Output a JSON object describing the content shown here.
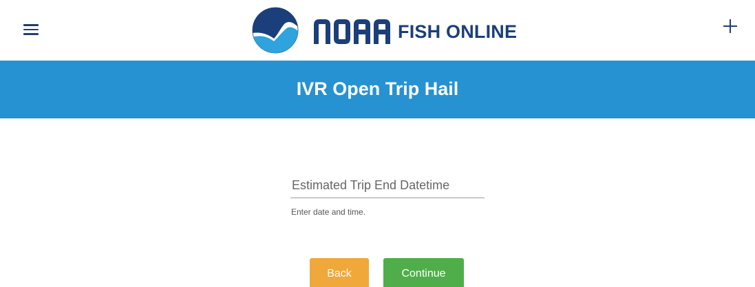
{
  "header": {
    "logo_wordmark": "NOAA",
    "logo_text": "FISH ONLINE",
    "menu_icon": "hamburger-menu-icon",
    "add_icon": "plus-icon"
  },
  "banner": {
    "title": "IVR Open Trip Hail"
  },
  "form": {
    "field_placeholder": "Estimated Trip End Datetime",
    "field_value": "",
    "field_hint": "Enter date and time."
  },
  "buttons": {
    "back_label": "Back",
    "continue_label": "Continue"
  },
  "colors": {
    "banner": "#2692d2",
    "brand_navy": "#1b3f7a",
    "back_button": "#f0a83a",
    "continue_button": "#4fae4a"
  }
}
